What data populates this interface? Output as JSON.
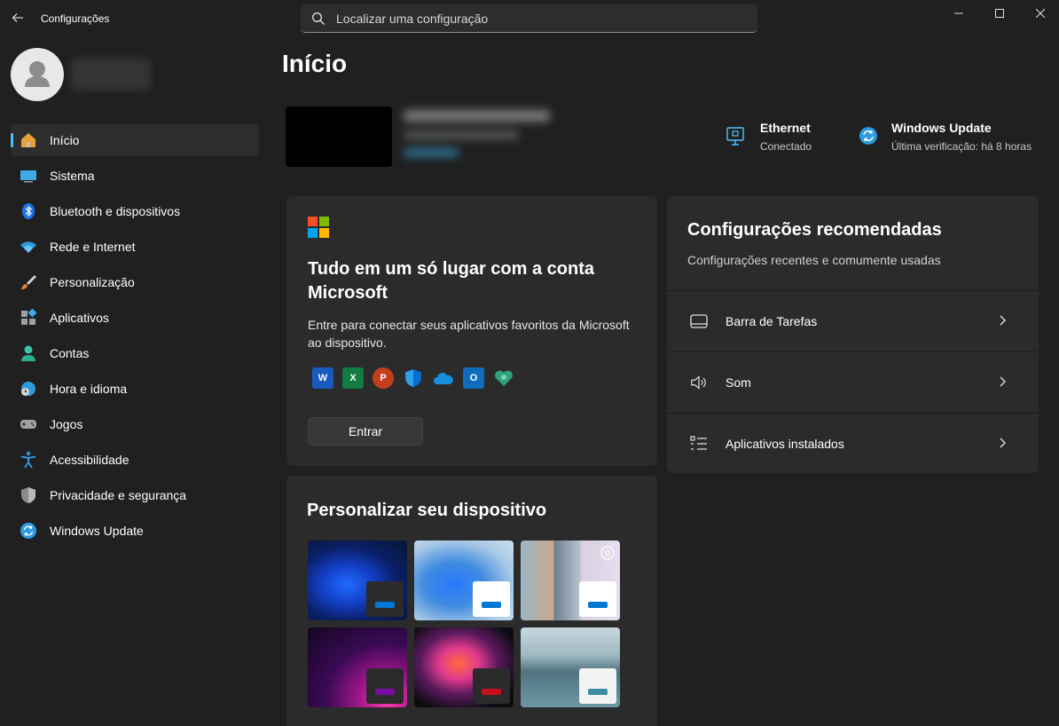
{
  "app": {
    "title": "Configurações",
    "search_placeholder": "Localizar uma configuração"
  },
  "window_controls": [
    "minimize-icon",
    "maximize-icon",
    "close-icon"
  ],
  "sidebar": {
    "items": [
      {
        "label": "Início",
        "icon": "home-icon",
        "active": true
      },
      {
        "label": "Sistema",
        "icon": "monitor-icon"
      },
      {
        "label": "Bluetooth e dispositivos",
        "icon": "bluetooth-icon"
      },
      {
        "label": "Rede e Internet",
        "icon": "wifi-icon"
      },
      {
        "label": "Personalização",
        "icon": "brush-icon"
      },
      {
        "label": "Aplicativos",
        "icon": "apps-icon"
      },
      {
        "label": "Contas",
        "icon": "person-icon"
      },
      {
        "label": "Hora e idioma",
        "icon": "clock-globe-icon"
      },
      {
        "label": "Jogos",
        "icon": "gamepad-icon"
      },
      {
        "label": "Acessibilidade",
        "icon": "accessibility-icon"
      },
      {
        "label": "Privacidade e segurança",
        "icon": "shield-icon"
      },
      {
        "label": "Windows Update",
        "icon": "update-icon"
      }
    ]
  },
  "main": {
    "title": "Início",
    "status": {
      "ethernet": {
        "title": "Ethernet",
        "sub": "Conectado"
      },
      "update": {
        "title": "Windows Update",
        "sub": "Última verificação: há 8 horas"
      }
    },
    "microsoft_card": {
      "title": "Tudo em um só lugar com a conta Microsoft",
      "description": "Entre para conectar seus aplicativos favoritos da Microsoft ao dispositivo.",
      "button": "Entrar",
      "apps": [
        "word-icon",
        "excel-icon",
        "powerpoint-icon",
        "defender-icon",
        "onedrive-icon",
        "outlook-icon",
        "family-icon"
      ]
    },
    "recommended": {
      "title": "Configurações recomendadas",
      "subtitle": "Configurações recentes e comumente usadas",
      "items": [
        {
          "label": "Barra de Tarefas",
          "icon": "taskbar-icon"
        },
        {
          "label": "Som",
          "icon": "speaker-icon"
        },
        {
          "label": "Aplicativos instalados",
          "icon": "list-icon"
        }
      ]
    },
    "personalize": {
      "title": "Personalizar seu dispositivo",
      "themes": [
        {
          "name": "windows-dark",
          "accent": "#0078d4"
        },
        {
          "name": "windows-light",
          "accent": "#0078d4"
        },
        {
          "name": "spotlight",
          "accent": "#0078d4"
        },
        {
          "name": "glow",
          "accent": "#7a0ca3"
        },
        {
          "name": "captured-motion",
          "accent": "#c50f1f"
        },
        {
          "name": "flow",
          "accent": "#3c8ea0"
        }
      ]
    }
  },
  "colors": {
    "accent": "#4cc2ff",
    "background": "#202020",
    "card": "#2b2b2b"
  }
}
